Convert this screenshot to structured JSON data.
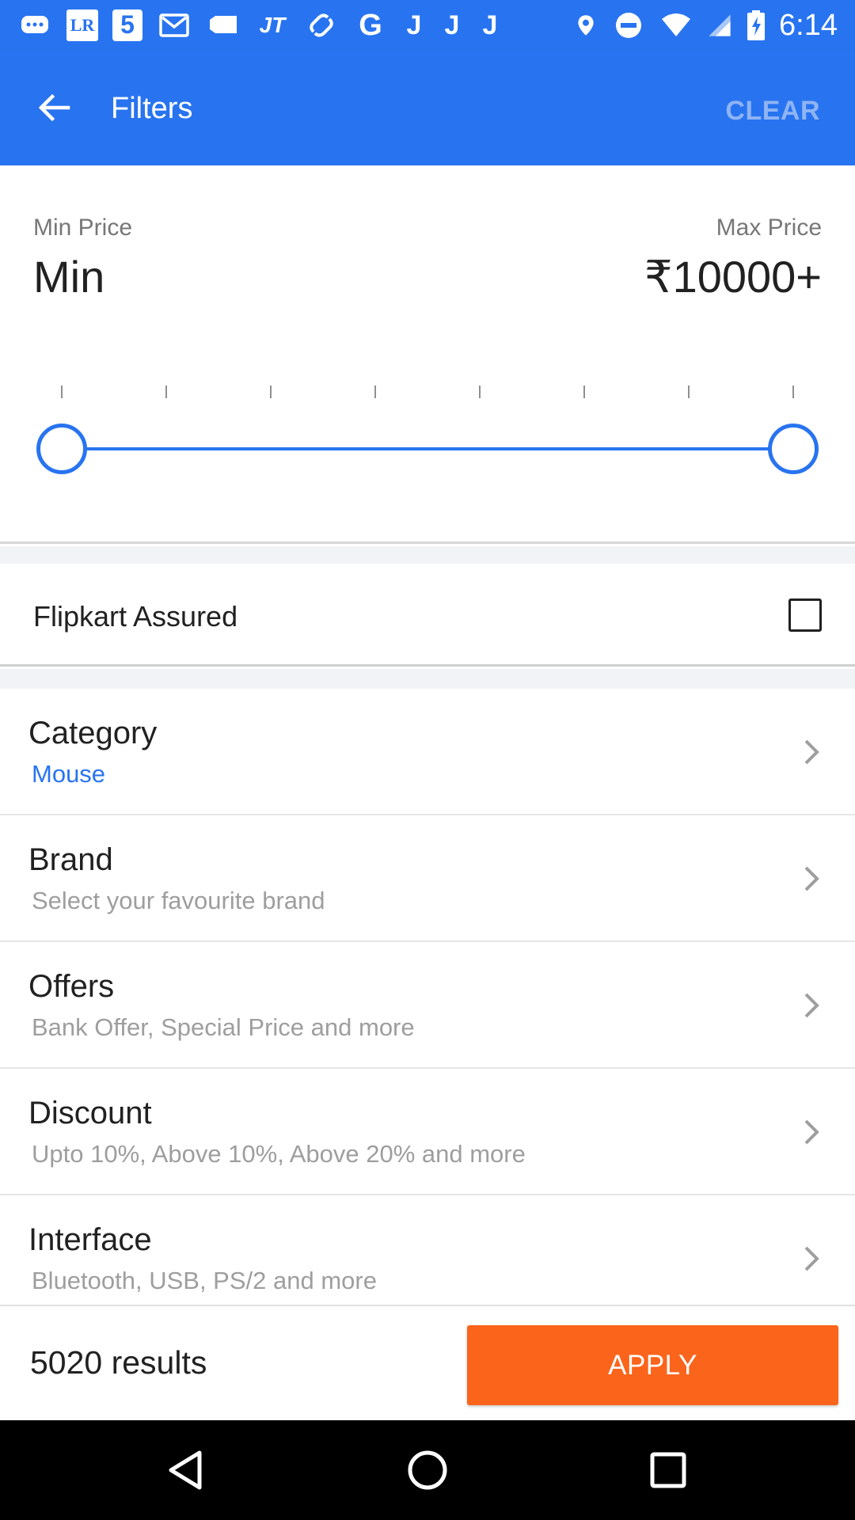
{
  "status_bar": {
    "icons": [
      "chat-icon",
      "lr-app-icon",
      "five-app-icon",
      "mail-icon",
      "tag-icon",
      "jt-app-icon",
      "link-icon",
      "google-icon",
      "j-app-icon",
      "j-app-icon",
      "j-app-icon",
      "location-icon",
      "do-not-disturb-icon",
      "wifi-icon",
      "cell-signal-icon",
      "battery-charging-icon"
    ],
    "lr_text": "LR",
    "five_text": "5",
    "jt_text": "JT",
    "g_text": "G",
    "j_text": "J",
    "time": "6:14"
  },
  "toolbar": {
    "title": "Filters",
    "clear_label": "CLEAR",
    "back_icon": "arrow-back-icon"
  },
  "price": {
    "min_label": "Min Price",
    "max_label": "Max Price",
    "min_value": "Min",
    "max_value": "₹10000+",
    "tick_count": 8,
    "range_start_fraction": 0,
    "range_end_fraction": 1
  },
  "assured": {
    "label": "Flipkart Assured",
    "checked": false
  },
  "filters": [
    {
      "title": "Category",
      "subtitle": "Mouse",
      "accent": true
    },
    {
      "title": "Brand",
      "subtitle": "Select your favourite brand",
      "accent": false
    },
    {
      "title": "Offers",
      "subtitle": "Bank Offer, Special Price and more",
      "accent": false
    },
    {
      "title": "Discount",
      "subtitle": "Upto 10%, Above 10%, Above 20% and more",
      "accent": false
    },
    {
      "title": "Interface",
      "subtitle": "Bluetooth, USB, PS/2 and more",
      "accent": false
    }
  ],
  "footer": {
    "results": "5020 results",
    "apply_label": "APPLY"
  },
  "nav": {
    "icons": [
      "back-triangle-icon",
      "home-circle-icon",
      "recents-square-icon"
    ]
  },
  "colors": {
    "primary": "#2874f0",
    "apply": "#fb641b",
    "clear_text": "#8fb4f4"
  }
}
